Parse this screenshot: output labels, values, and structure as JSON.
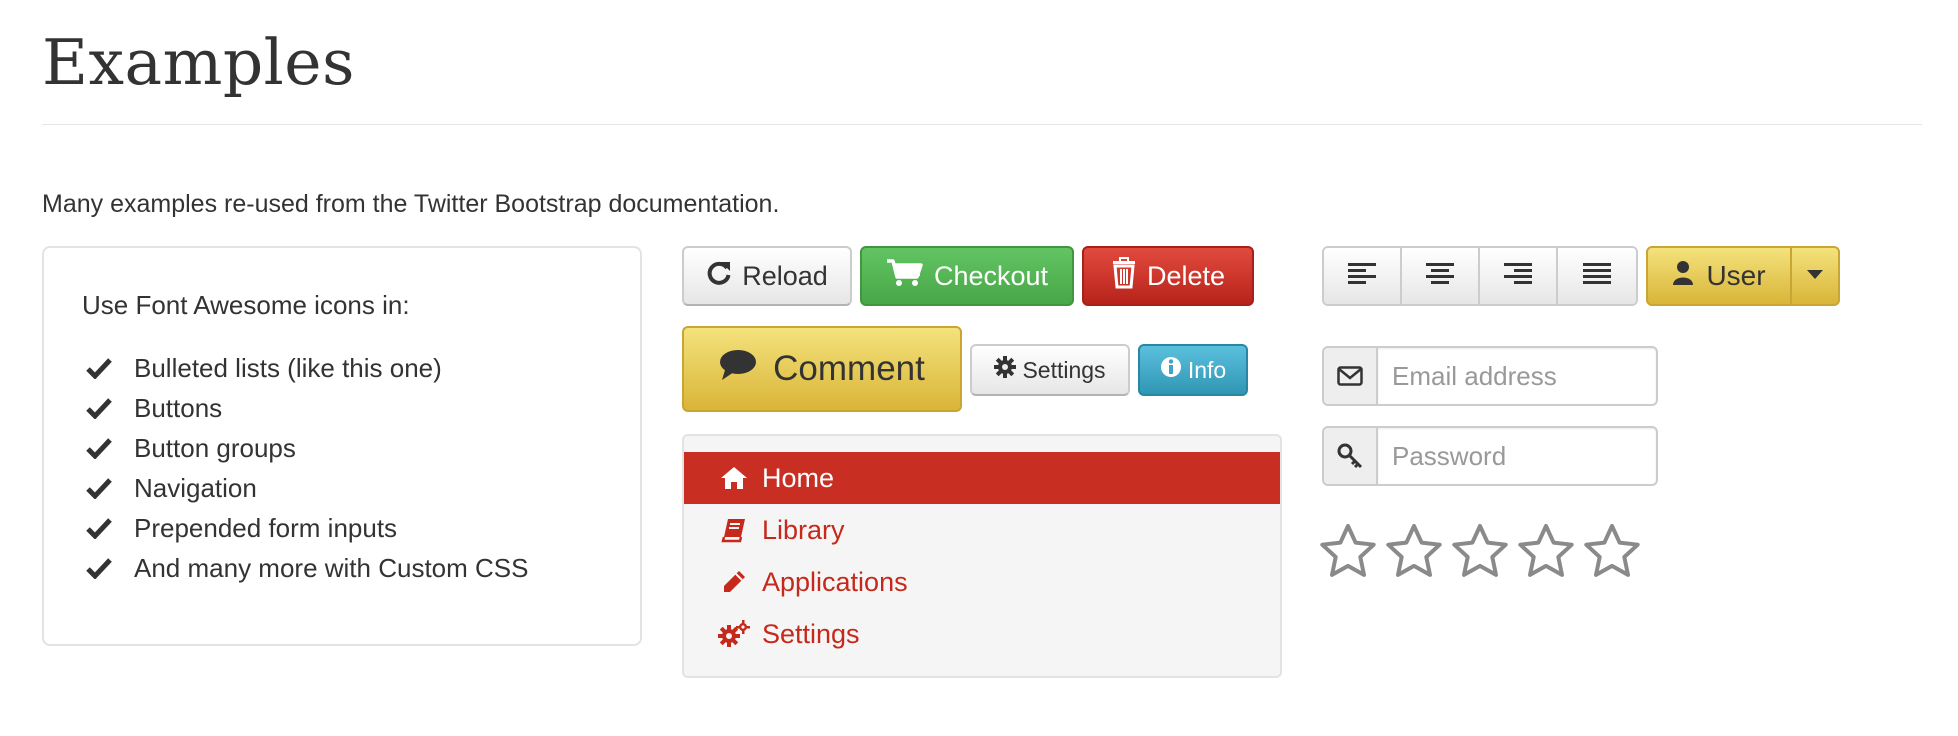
{
  "page": {
    "title": "Examples",
    "intro": "Many examples re-used from the Twitter Bootstrap documentation."
  },
  "feature_list": {
    "heading": "Use Font Awesome icons in:",
    "icon": "check-icon",
    "items": [
      "Bulleted lists (like this one)",
      "Buttons",
      "Button groups",
      "Navigation",
      "Prepended form inputs",
      "And many more with Custom CSS"
    ]
  },
  "buttons": {
    "reload": {
      "label": "Reload",
      "icon": "refresh-icon"
    },
    "checkout": {
      "label": "Checkout",
      "icon": "shopping-cart-icon",
      "color": "#4cae4c"
    },
    "delete": {
      "label": "Delete",
      "icon": "trash-icon",
      "color": "#c9302c"
    },
    "comment": {
      "label": "Comment",
      "icon": "comment-icon",
      "color": "#e0c04a"
    },
    "settings": {
      "label": "Settings",
      "icon": "cog-icon"
    },
    "info": {
      "label": "Info",
      "icon": "info-sign-icon",
      "color": "#3aa6cb"
    }
  },
  "nav": {
    "accent": "#c92e23",
    "items": [
      {
        "label": "Home",
        "icon": "home-icon",
        "active": true
      },
      {
        "label": "Library",
        "icon": "book-icon",
        "active": false
      },
      {
        "label": "Applications",
        "icon": "pencil-icon",
        "active": false
      },
      {
        "label": "Settings",
        "icon": "cogs-icon",
        "active": false
      }
    ]
  },
  "align_group": {
    "buttons": [
      "align-left-icon",
      "align-center-icon",
      "align-right-icon",
      "align-justify-icon"
    ]
  },
  "user_dropdown": {
    "label": "User",
    "icon": "user-icon",
    "caret": "caret-down-icon"
  },
  "form": {
    "email": {
      "placeholder": "Email address",
      "value": "",
      "icon": "envelope-icon"
    },
    "password": {
      "placeholder": "Password",
      "value": "",
      "icon": "key-icon"
    }
  },
  "rating": {
    "total": 5,
    "filled": 0,
    "icon": "star-empty-icon"
  }
}
